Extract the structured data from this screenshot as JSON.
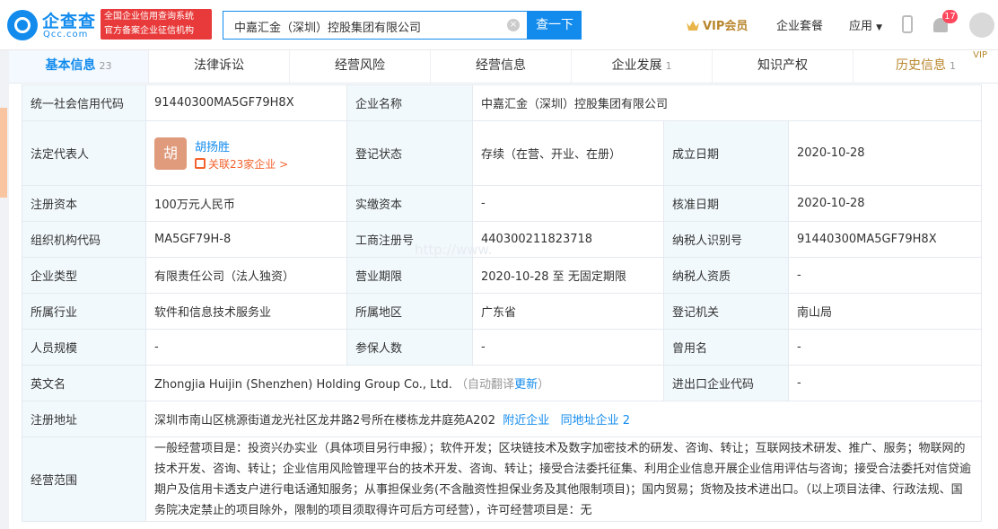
{
  "header": {
    "logo_name": "企查查",
    "logo_sub": "Qcc.com",
    "badge_line1": "全国企业信用查询系统",
    "badge_line2": "官方备案企业征信机构",
    "search_value": "中嘉汇金（深圳）控股集团有限公司",
    "search_button": "查一下",
    "vip_label": "VIP会员",
    "suite_label": "企业套餐",
    "apps_label": "应用",
    "notifications": "17"
  },
  "tabs": [
    {
      "label": "基本信息",
      "count": "23"
    },
    {
      "label": "法律诉讼",
      "count": ""
    },
    {
      "label": "经营风险",
      "count": ""
    },
    {
      "label": "经营信息",
      "count": ""
    },
    {
      "label": "企业发展",
      "count": "1"
    },
    {
      "label": "知识产权",
      "count": ""
    },
    {
      "label": "历史信息",
      "count": "1",
      "vip": "VIP"
    }
  ],
  "watermark": "http://www.",
  "info": {
    "credit_code_label": "统一社会信用代码",
    "credit_code": "91440300MA5GF79H8X",
    "company_name_label": "企业名称",
    "company_name": "中嘉汇金（深圳）控股集团有限公司",
    "legal_rep_label": "法定代表人",
    "legal_rep_avatar": "胡",
    "legal_rep_name": "胡扬胜",
    "legal_rep_related": "关联23家企业 >",
    "reg_status_label": "登记状态",
    "reg_status": "存续（在营、开业、在册）",
    "found_date_label": "成立日期",
    "found_date": "2020-10-28",
    "reg_capital_label": "注册资本",
    "reg_capital": "100万元人民币",
    "paid_capital_label": "实缴资本",
    "paid_capital": "-",
    "approve_date_label": "核准日期",
    "approve_date": "2020-10-28",
    "org_code_label": "组织机构代码",
    "org_code": "MA5GF79H-8",
    "biz_reg_no_label": "工商注册号",
    "biz_reg_no": "440300211823718",
    "taxpayer_id_label": "纳税人识别号",
    "taxpayer_id": "91440300MA5GF79H8X",
    "company_type_label": "企业类型",
    "company_type": "有限责任公司（法人独资）",
    "biz_term_label": "营业期限",
    "biz_term": "2020-10-28 至 无固定期限",
    "taxpayer_qual_label": "纳税人资质",
    "taxpayer_qual": "-",
    "industry_label": "所属行业",
    "industry": "软件和信息技术服务业",
    "region_label": "所属地区",
    "region": "广东省",
    "reg_authority_label": "登记机关",
    "reg_authority": "南山局",
    "staff_size_label": "人员规模",
    "staff_size": "-",
    "insured_label": "参保人数",
    "insured": "-",
    "former_name_label": "曾用名",
    "former_name": "-",
    "english_name_label": "英文名",
    "english_name": "Zhongjia Huijin (Shenzhen) Holding Group Co., Ltd.",
    "auto_translate": "（自动翻译",
    "update_link": "更新",
    "auto_translate_end": "）",
    "import_export_label": "进出口企业代码",
    "import_export": "-",
    "address_label": "注册地址",
    "address": "深圳市南山区桃源街道龙光社区龙井路2号所在楼栋龙井庭苑A202",
    "nearby_link": "附近企业",
    "same_address_link": "同地址企业 2",
    "scope_label": "经营范围",
    "scope": "一般经营项目是：投资兴办实业（具体项目另行申报）；软件开发；区块链技术及数字加密技术的研发、咨询、转让；互联网技术研发、推广、服务；物联网的技术开发、咨询、转让；企业信用风险管理平台的技术开发、咨询、转让；接受合法委托征集、利用企业信息开展企业信用评估与咨询；接受合法委托对信贷逾期户及信用卡透支户进行电话通知服务；从事担保业务(不含融资性担保业务及其他限制项目)；国内贸易；货物及技术进出口。（以上项目法律、行政法规、国务院决定禁止的项目除外，限制的项目须取得许可后方可经营），许可经营项目是：无"
  }
}
